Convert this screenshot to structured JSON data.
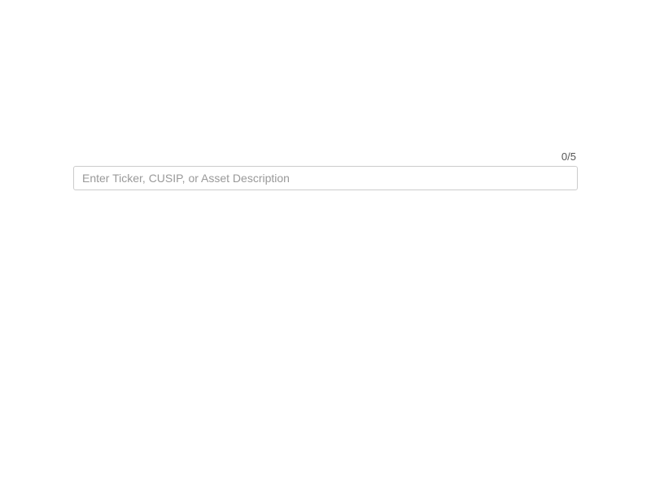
{
  "search": {
    "counter": "0/5",
    "placeholder": "Enter Ticker, CUSIP, or Asset Description",
    "value": ""
  }
}
